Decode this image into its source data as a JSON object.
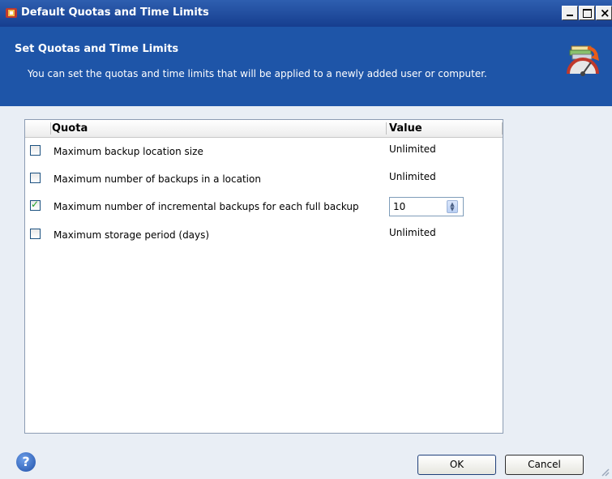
{
  "window": {
    "title": "Default Quotas and Time Limits"
  },
  "header": {
    "title": "Set Quotas and Time Limits",
    "description": "You can set the quotas and time limits that will be applied to a newly added user or computer."
  },
  "grid": {
    "columns": {
      "quota": "Quota",
      "value": "Value"
    },
    "rows": [
      {
        "label": "Maximum backup location size",
        "checked": false,
        "value": "Unlimited"
      },
      {
        "label": "Maximum number of backups in a location",
        "checked": false,
        "value": "Unlimited"
      },
      {
        "label": "Maximum number of incremental backups for each full backup",
        "checked": true,
        "value": "10"
      },
      {
        "label": "Maximum storage period (days)",
        "checked": false,
        "value": "Unlimited"
      }
    ]
  },
  "footer": {
    "help_icon": "help-icon",
    "ok_label": "OK",
    "cancel_label": "Cancel"
  },
  "colors": {
    "header_bg": "#1e55a8",
    "titlebar": "#2e5fb0",
    "accent_check": "#21a121"
  }
}
